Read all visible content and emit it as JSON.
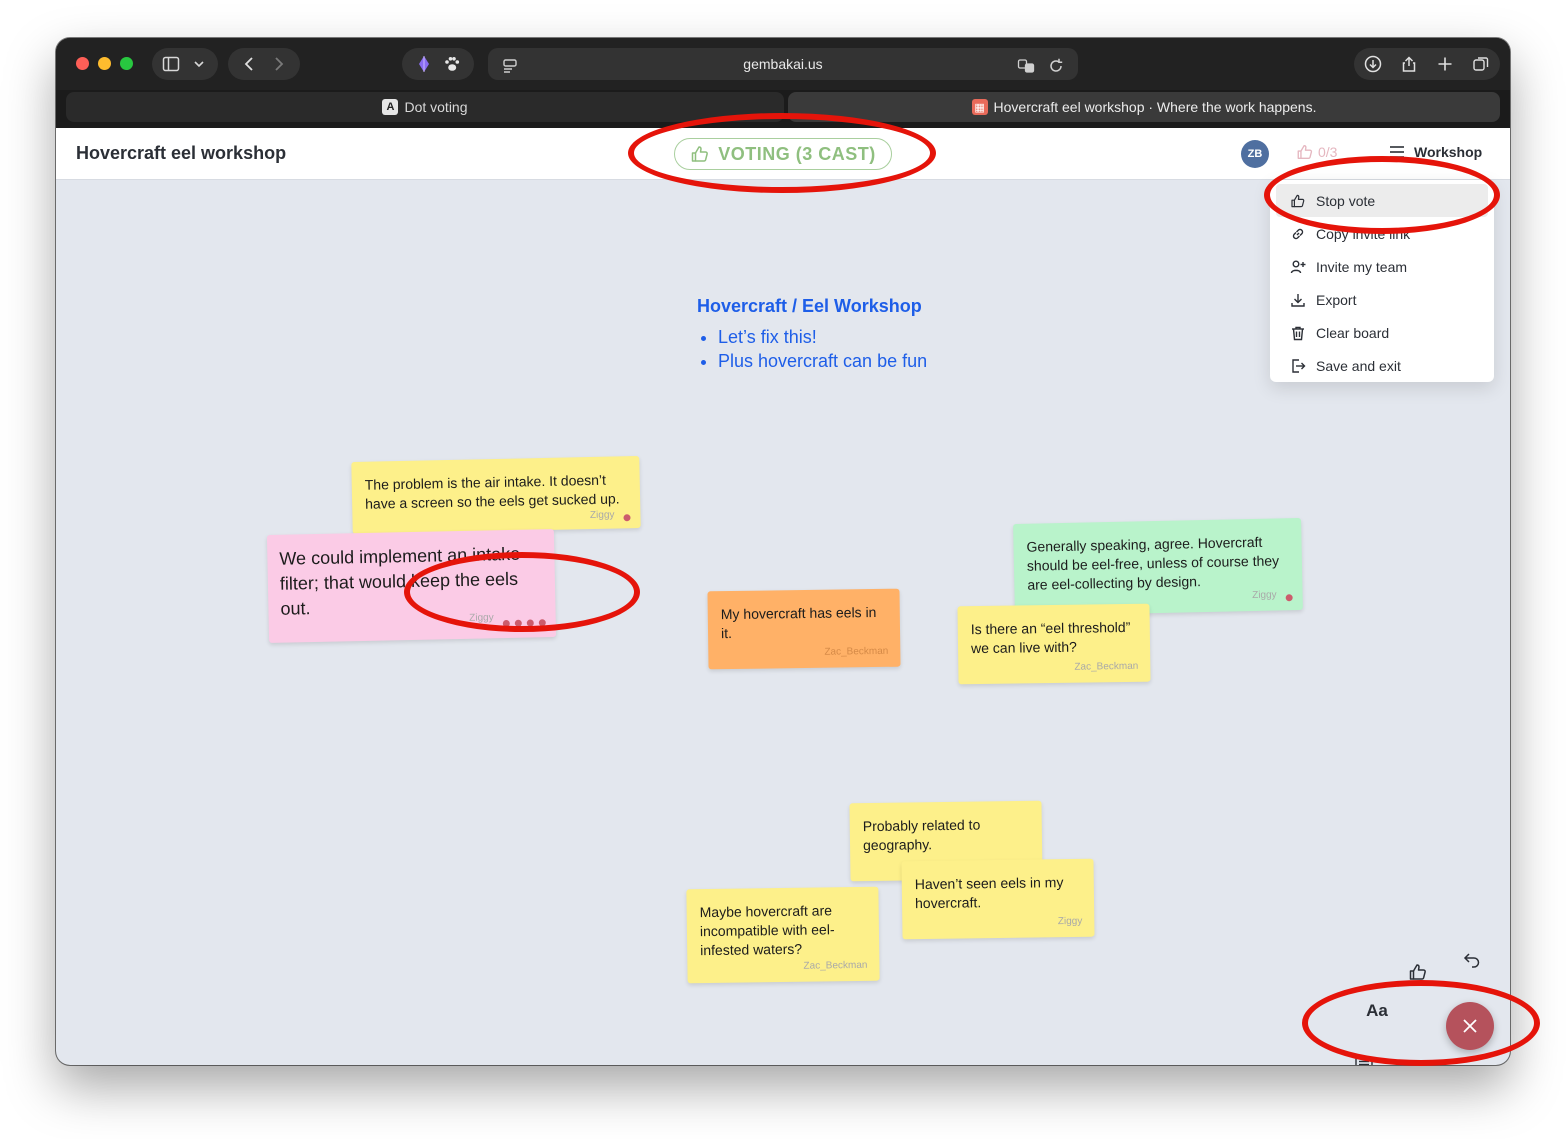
{
  "browser": {
    "address": "gembakai.us",
    "tabs": [
      {
        "label": "Dot voting"
      },
      {
        "label": "Hovercraft eel workshop · Where the work happens."
      }
    ]
  },
  "header": {
    "board_title": "Hovercraft eel workshop",
    "voting_status": "VOTING (3 CAST)",
    "avatar_initials": "ZB",
    "vote_count": "0/3",
    "menu_label": "Workshop"
  },
  "menu": {
    "items": [
      {
        "label": "Stop vote",
        "icon": "thumbs-up-icon"
      },
      {
        "label": "Copy invite link",
        "icon": "link-icon"
      },
      {
        "label": "Invite my team",
        "icon": "add-user-icon"
      },
      {
        "label": "Export",
        "icon": "download-icon"
      },
      {
        "label": "Clear board",
        "icon": "trash-icon"
      },
      {
        "label": "Save and exit",
        "icon": "exit-icon"
      }
    ]
  },
  "canvas": {
    "text_block": {
      "title": "Hovercraft / Eel Workshop",
      "bullets": [
        "Let’s fix this!",
        "Plus hovercraft can be fun"
      ]
    },
    "stickies": [
      {
        "text": "The problem is the air intake. It doesn’t have a screen so the eels get sucked up.",
        "author": "Ziggy",
        "color": "#fdf08a",
        "votes": 1
      },
      {
        "text": "We could implement an intake filter; that would keep the eels out.",
        "author": "Ziggy",
        "color": "#fbcbe6",
        "votes": 4
      },
      {
        "text": "My hovercraft has eels in it.",
        "author": "Zac_Beckman",
        "color": "#ffb167",
        "votes": 0
      },
      {
        "text": "Generally speaking, agree. Hovercraft should be eel-free, unless of course they are eel-collecting by design.",
        "author": "Ziggy",
        "color": "#b9f3cb",
        "votes": 1
      },
      {
        "text": "Is there an “eel threshold” we can live with?",
        "author": "Zac_Beckman",
        "color": "#fdf08a",
        "votes": 0
      },
      {
        "text": "Probably related to geography.",
        "author": "",
        "color": "#fdf08a",
        "votes": 0
      },
      {
        "text": "Haven’t seen eels in my hovercraft.",
        "author": "Ziggy",
        "color": "#fdf08a",
        "votes": 0
      },
      {
        "text": "Maybe hovercraft are incompatible with eel-infested waters?",
        "author": "Zac_Beckman",
        "color": "#fdf08a",
        "votes": 0
      }
    ]
  },
  "tools": {
    "text_tool_label": "Aa"
  },
  "colors": {
    "voting_green": "#8fbf7f",
    "vote_dot": "#cc5c6c",
    "fab": "#b5525c",
    "annotation_red": "#e5140a",
    "text_block_blue": "#1e5ee8"
  }
}
